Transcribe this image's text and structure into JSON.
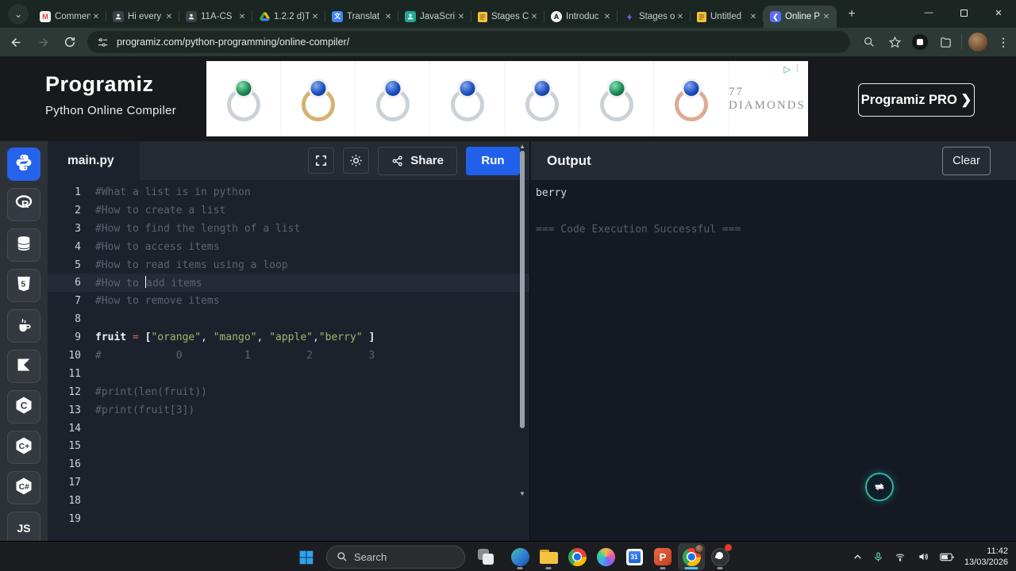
{
  "browser": {
    "tabs": [
      {
        "icon": "gmail",
        "title": "Commen"
      },
      {
        "icon": "person",
        "title": "Hi every"
      },
      {
        "icon": "person",
        "title": "11A-CS"
      },
      {
        "icon": "drive",
        "title": "1.2.2 d)T"
      },
      {
        "icon": "translate",
        "title": "Translat"
      },
      {
        "icon": "person-teal",
        "title": "JavaScri"
      },
      {
        "icon": "doc",
        "title": "Stages C"
      },
      {
        "icon": "circle-a",
        "title": "Introduc"
      },
      {
        "icon": "bolt",
        "title": "Stages o"
      },
      {
        "icon": "doc",
        "title": "Untitled"
      },
      {
        "icon": "programiz",
        "title": "Online P",
        "active": true
      }
    ],
    "close_glyph": "✕",
    "new_tab_glyph": "+",
    "tab_search_glyph": "⌄",
    "window": {
      "min": "—",
      "close": "✕"
    },
    "url": "programiz.com/python-programming/online-compiler/"
  },
  "header": {
    "logo": "Programiz",
    "subtitle": "Python Online Compiler",
    "pro_button": "Programiz PRO ❯",
    "ad": {
      "brand": "77 DIAMONDS",
      "adchoices_glyph": "▷",
      "dots_glyph": "⋮",
      "rings": [
        {
          "band": "silver",
          "gem": "green"
        },
        {
          "band": "gold",
          "gem": "blue"
        },
        {
          "band": "silver",
          "gem": "blue"
        },
        {
          "band": "silver",
          "gem": "blue"
        },
        {
          "band": "silver",
          "gem": "blue"
        },
        {
          "band": "silver",
          "gem": "green"
        },
        {
          "band": "rose",
          "gem": "blue"
        }
      ]
    }
  },
  "sidebar": {
    "items": [
      {
        "id": "python",
        "label": "Python",
        "active": true
      },
      {
        "id": "r",
        "label": "R"
      },
      {
        "id": "sql",
        "label": "SQL"
      },
      {
        "id": "html",
        "label": "HTML"
      },
      {
        "id": "java",
        "label": "Java"
      },
      {
        "id": "kotlin",
        "label": "Kotlin"
      },
      {
        "id": "c",
        "label": "C"
      },
      {
        "id": "cpp",
        "label": "C++"
      },
      {
        "id": "csharp",
        "label": "C#"
      },
      {
        "id": "js",
        "label": "JavaScript"
      }
    ]
  },
  "editor": {
    "filename": "main.py",
    "share_label": "Share",
    "run_label": "Run",
    "lines": [
      {
        "n": "1",
        "segs": [
          [
            "#What a list is in python",
            "cm"
          ]
        ]
      },
      {
        "n": "2",
        "segs": [
          [
            "#How to create a list",
            "cm"
          ]
        ]
      },
      {
        "n": "3",
        "segs": [
          [
            "#How to find the length of a list",
            "cm"
          ]
        ]
      },
      {
        "n": "4",
        "segs": [
          [
            "#How to access items",
            "cm"
          ]
        ]
      },
      {
        "n": "5",
        "segs": [
          [
            "#How to read items using a loop",
            "cm"
          ]
        ]
      },
      {
        "n": "6",
        "hl": true,
        "segs": [
          [
            "#How to ",
            "cm"
          ],
          [
            "CARET",
            "caret"
          ],
          [
            "add items",
            "cm"
          ]
        ]
      },
      {
        "n": "7",
        "segs": [
          [
            "#How to remove items",
            "cm"
          ]
        ]
      },
      {
        "n": "8",
        "segs": []
      },
      {
        "n": "9",
        "segs": [
          [
            "fruit",
            "v"
          ],
          [
            " ",
            ""
          ],
          [
            "=",
            "op"
          ],
          [
            " ",
            ""
          ],
          [
            "[",
            "br"
          ],
          [
            "\"orange\"",
            "st"
          ],
          [
            ", ",
            ""
          ],
          [
            "\"mango\"",
            "st"
          ],
          [
            ", ",
            ""
          ],
          [
            "\"apple\"",
            "st"
          ],
          [
            ",",
            ""
          ],
          [
            "\"berry\"",
            "st"
          ],
          [
            " ",
            ""
          ],
          [
            "]",
            "br"
          ]
        ]
      },
      {
        "n": "10",
        "segs": [
          [
            "#            0          1         2         3",
            "cm"
          ]
        ]
      },
      {
        "n": "11",
        "segs": []
      },
      {
        "n": "12",
        "segs": [
          [
            "#print(len(fruit))",
            "cm"
          ]
        ]
      },
      {
        "n": "13",
        "segs": [
          [
            "#print(fruit[3])",
            "cm"
          ]
        ]
      },
      {
        "n": "14",
        "segs": []
      },
      {
        "n": "15",
        "segs": []
      },
      {
        "n": "16",
        "segs": []
      },
      {
        "n": "17",
        "segs": []
      },
      {
        "n": "18",
        "segs": []
      },
      {
        "n": "19",
        "segs": []
      }
    ]
  },
  "output": {
    "title": "Output",
    "clear_label": "Clear",
    "lines": [
      {
        "text": "berry",
        "dim": false
      },
      {
        "text": "",
        "dim": false
      },
      {
        "text": "=== Code Execution Successful ===",
        "dim": true
      }
    ]
  },
  "taskbar": {
    "search_label": "Search",
    "apps": [
      {
        "id": "edge",
        "running": true
      },
      {
        "id": "explorer",
        "running": true
      },
      {
        "id": "chrome",
        "running": false
      },
      {
        "id": "copilot",
        "running": false
      },
      {
        "id": "calendar",
        "running": false,
        "calendar_text": "31"
      },
      {
        "id": "powerpoint",
        "running": true,
        "glyph": "P"
      },
      {
        "id": "chrome-active",
        "running": true,
        "active": true,
        "accent": true
      },
      {
        "id": "obs",
        "running": true,
        "badge": true
      }
    ],
    "tray": {
      "time": "11:42",
      "date": "13/03/2026"
    }
  }
}
